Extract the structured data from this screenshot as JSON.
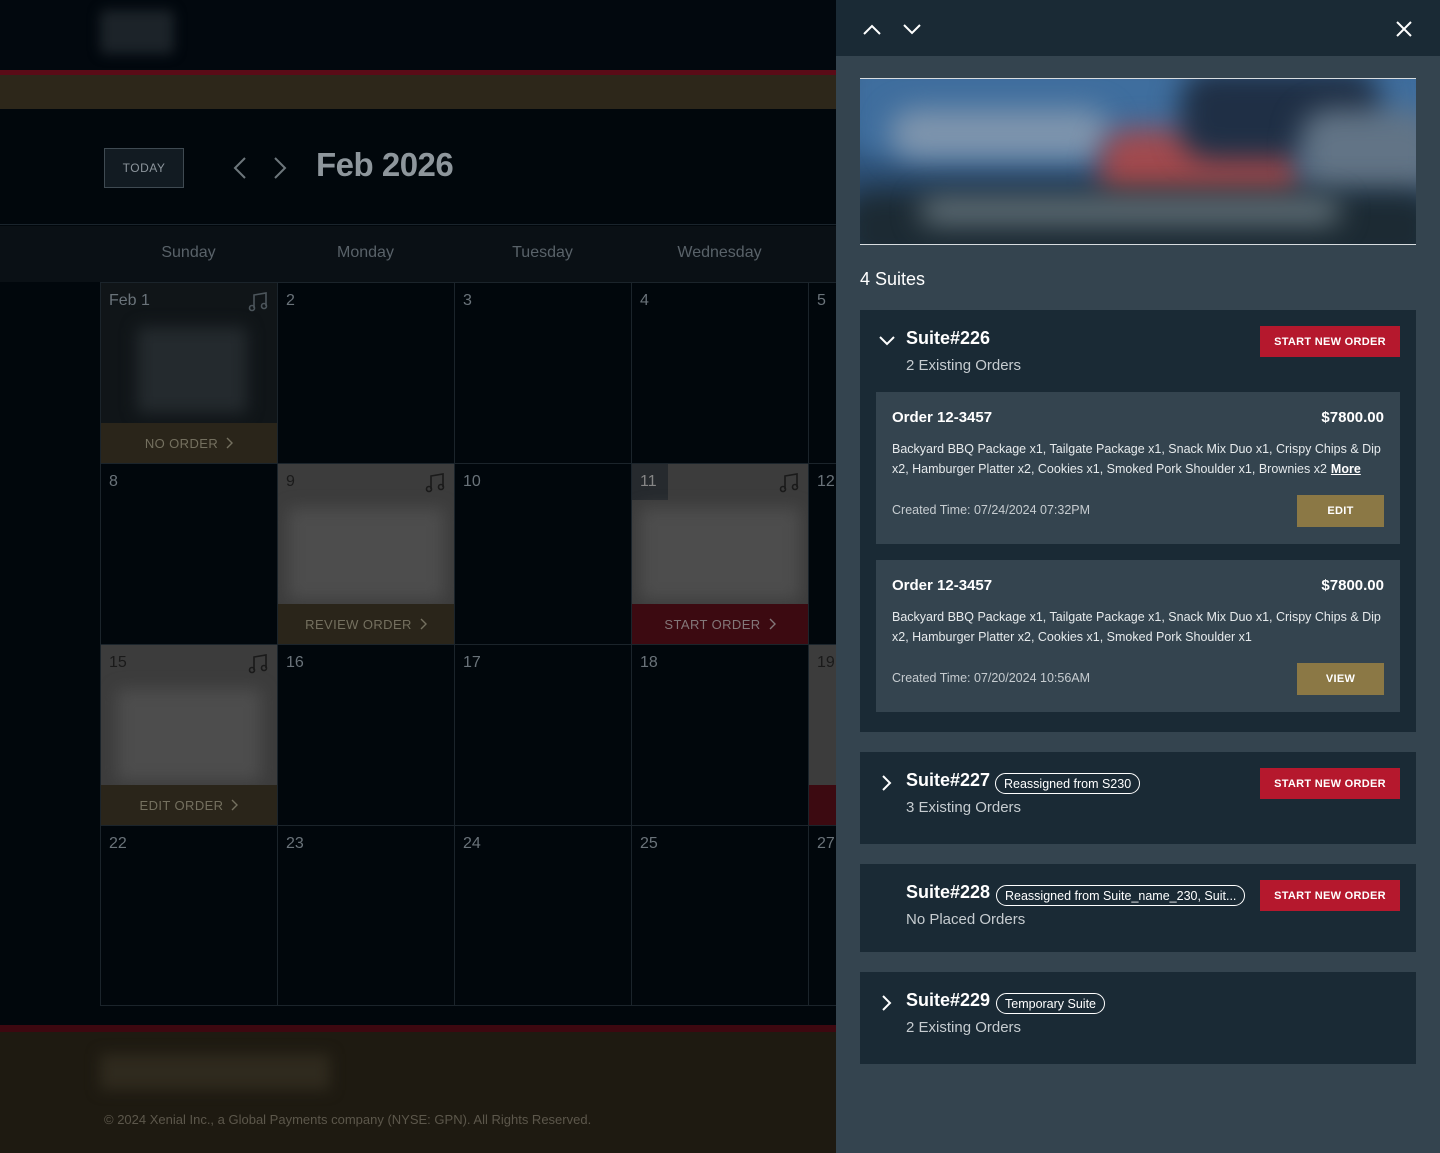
{
  "calendar": {
    "today_label": "TODAY",
    "month_title": "Feb 2026",
    "weekdays": [
      "Sunday",
      "Monday",
      "Tuesday",
      "Wednesday"
    ],
    "days": {
      "d1": "Feb 1",
      "d2": "2",
      "d3": "3",
      "d4": "4",
      "d5": "5",
      "d8": "8",
      "d9": "9",
      "d10": "10",
      "d11": "11",
      "d12": "12",
      "d15": "15",
      "d16": "16",
      "d17": "17",
      "d18": "18",
      "d19": "19",
      "d22": "22",
      "d23": "23",
      "d24": "24",
      "d25": "25",
      "d27": "27"
    },
    "actions": {
      "no_order": "NO ORDER",
      "review_order": "REVIEW ORDER",
      "start_order": "START ORDER",
      "edit_order": "EDIT ORDER"
    },
    "copyright": "© 2024 Xenial Inc., a Global Payments company (NYSE: GPN). All Rights Reserved."
  },
  "drawer": {
    "suites_count": "4 Suites",
    "start_new_order_label": "START NEW ORDER",
    "suites": [
      {
        "title": "Suite#226",
        "subtitle": "2 Existing Orders",
        "orders": [
          {
            "title": "Order 12-3457",
            "price": "$7800.00",
            "items": "Backyard BBQ Package x1, Tailgate Package x1, Snack Mix Duo x1, Crispy Chips & Dip x2, Hamburger Platter x2, Cookies x1, Smoked Pork Shoulder x1, Brownies x2",
            "more": "More",
            "created": "Created Time: 07/24/2024 07:32PM",
            "button": "EDIT"
          },
          {
            "title": "Order 12-3457",
            "price": "$7800.00",
            "items": "Backyard BBQ Package x1, Tailgate Package x1, Snack Mix Duo x1, Crispy Chips & Dip x2, Hamburger Platter x2, Cookies x1, Smoked Pork Shoulder x1",
            "created": "Created Time: 07/20/2024 10:56AM",
            "button": "VIEW"
          }
        ]
      },
      {
        "title": "Suite#227",
        "tag": "Reassigned from S230",
        "subtitle": "3 Existing Orders"
      },
      {
        "title": "Suite#228",
        "tag": "Reassigned from Suite_name_230, Suit...",
        "subtitle": "No Placed Orders"
      },
      {
        "title": "Suite#229",
        "tag": "Temporary Suite",
        "subtitle": "2 Existing Orders"
      }
    ]
  },
  "colors": {
    "accent_red": "#b5182d",
    "accent_gold": "#8b7845",
    "drawer_bg": "#34444f",
    "card_bg": "#1a2a35"
  }
}
